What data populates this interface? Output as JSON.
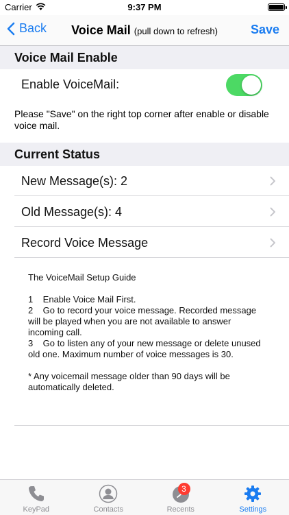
{
  "status_bar": {
    "carrier": "Carrier",
    "time": "9:37 PM"
  },
  "nav": {
    "back_label": "Back",
    "title": "Voice Mail",
    "subtitle": "(pull down to refresh)",
    "save_label": "Save"
  },
  "sections": {
    "enable": {
      "header": "Voice Mail Enable",
      "toggle_label": "Enable VoiceMail:",
      "toggle_on": true,
      "note": "Please \"Save\" on the right top corner after enable or disable voice mail."
    },
    "status": {
      "header": "Current Status",
      "rows": [
        {
          "label": "New Message(s): 2"
        },
        {
          "label": "Old Message(s): 4"
        },
        {
          "label": "Record Voice Message"
        }
      ]
    }
  },
  "guide": {
    "title": "The VoiceMail Setup Guide",
    "steps": [
      "1    Enable Voice Mail First.",
      "2    Go to record your voice message. Recorded message will be played when you are not available to answer incoming call.",
      "3    Go to listen any of your new message or delete unused old one. Maximum number of voice messages is 30."
    ],
    "footnote": "* Any voicemail message older than 90 days will be automatically deleted."
  },
  "tab_bar": {
    "tabs": [
      {
        "label": "KeyPad",
        "icon": "phone-icon"
      },
      {
        "label": "Contacts",
        "icon": "contacts-icon"
      },
      {
        "label": "Recents",
        "icon": "clock-icon",
        "badge": "3"
      },
      {
        "label": "Settings",
        "icon": "gear-icon",
        "active": true
      }
    ]
  },
  "colors": {
    "accent": "#1a7cf0",
    "toggle_on": "#4cd964",
    "badge": "#ff3b30",
    "section_bg": "#efeff4"
  }
}
